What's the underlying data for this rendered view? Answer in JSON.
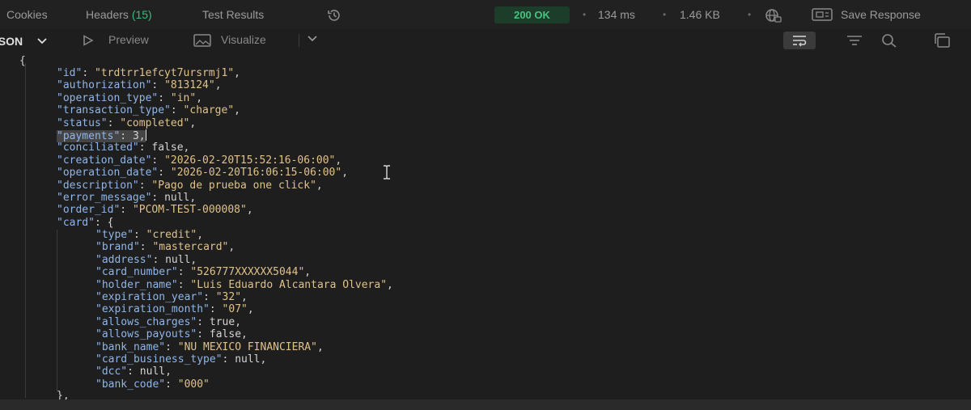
{
  "tabs": {
    "cookies": "Cookies",
    "headers_label": "Headers",
    "headers_count": "(15)",
    "test_results": "Test Results"
  },
  "response": {
    "status": "200 OK",
    "time": "134 ms",
    "size": "1.46 KB",
    "save_label": "Save Response"
  },
  "toolbar": {
    "format": "JSON",
    "preview": "Preview",
    "visualize": "Visualize"
  },
  "icons": {
    "history": "history-icon",
    "network": "globe-icon",
    "save": "save-icon",
    "wrap": "wrap-lines-icon",
    "filter": "filter-icon",
    "search": "search-icon",
    "copy": "copy-icon"
  },
  "colors": {
    "status_ok": "#48c27f",
    "key": "#8fb6ea",
    "string": "#e0c28a",
    "background": "#1e1e1e"
  },
  "body": {
    "open_brace": "{",
    "fields": [
      {
        "key": "\"id\"",
        "value": "\"trdtrr1efcyt7ursrmj1\"",
        "comma": ","
      },
      {
        "key": "\"authorization\"",
        "value": "\"813124\"",
        "comma": ","
      },
      {
        "key": "\"operation_type\"",
        "value": "\"in\"",
        "comma": ","
      },
      {
        "key": "\"transaction_type\"",
        "value": "\"charge\"",
        "comma": ","
      },
      {
        "key": "\"status\"",
        "value": "\"completed\"",
        "comma": ","
      },
      {
        "key": "\"payments\"",
        "value": "3",
        "comma": ","
      },
      {
        "key": "\"conciliated\"",
        "value": "false",
        "comma": ","
      },
      {
        "key": "\"creation_date\"",
        "value": "\"2026-02-20T15:52:16-06:00\"",
        "comma": ","
      },
      {
        "key": "\"operation_date\"",
        "value": "\"2026-02-20T16:06:15-06:00\"",
        "comma": ","
      },
      {
        "key": "\"description\"",
        "value": "\"Pago de prueba one click\"",
        "comma": ","
      },
      {
        "key": "\"error_message\"",
        "value": "null",
        "comma": ","
      },
      {
        "key": "\"order_id\"",
        "value": "\"PCOM-TEST-000008\"",
        "comma": ","
      },
      {
        "key": "\"card\"",
        "value": "{",
        "comma": ""
      }
    ],
    "card_fields": [
      {
        "key": "\"type\"",
        "value": "\"credit\"",
        "comma": ","
      },
      {
        "key": "\"brand\"",
        "value": "\"mastercard\"",
        "comma": ","
      },
      {
        "key": "\"address\"",
        "value": "null",
        "comma": ","
      },
      {
        "key": "\"card_number\"",
        "value": "\"526777XXXXXX5044\"",
        "comma": ","
      },
      {
        "key": "\"holder_name\"",
        "value": "\"Luis Eduardo Alcantara Olvera\"",
        "comma": ","
      },
      {
        "key": "\"expiration_year\"",
        "value": "\"32\"",
        "comma": ","
      },
      {
        "key": "\"expiration_month\"",
        "value": "\"07\"",
        "comma": ","
      },
      {
        "key": "\"allows_charges\"",
        "value": "true",
        "comma": ","
      },
      {
        "key": "\"allows_payouts\"",
        "value": "false",
        "comma": ","
      },
      {
        "key": "\"bank_name\"",
        "value": "\"NU MEXICO FINANCIERA\"",
        "comma": ","
      },
      {
        "key": "\"card_business_type\"",
        "value": "null",
        "comma": ","
      },
      {
        "key": "\"dcc\"",
        "value": "null",
        "comma": ","
      },
      {
        "key": "\"bank_code\"",
        "value": "\"000\"",
        "comma": ""
      }
    ],
    "close_card": "},"
  }
}
